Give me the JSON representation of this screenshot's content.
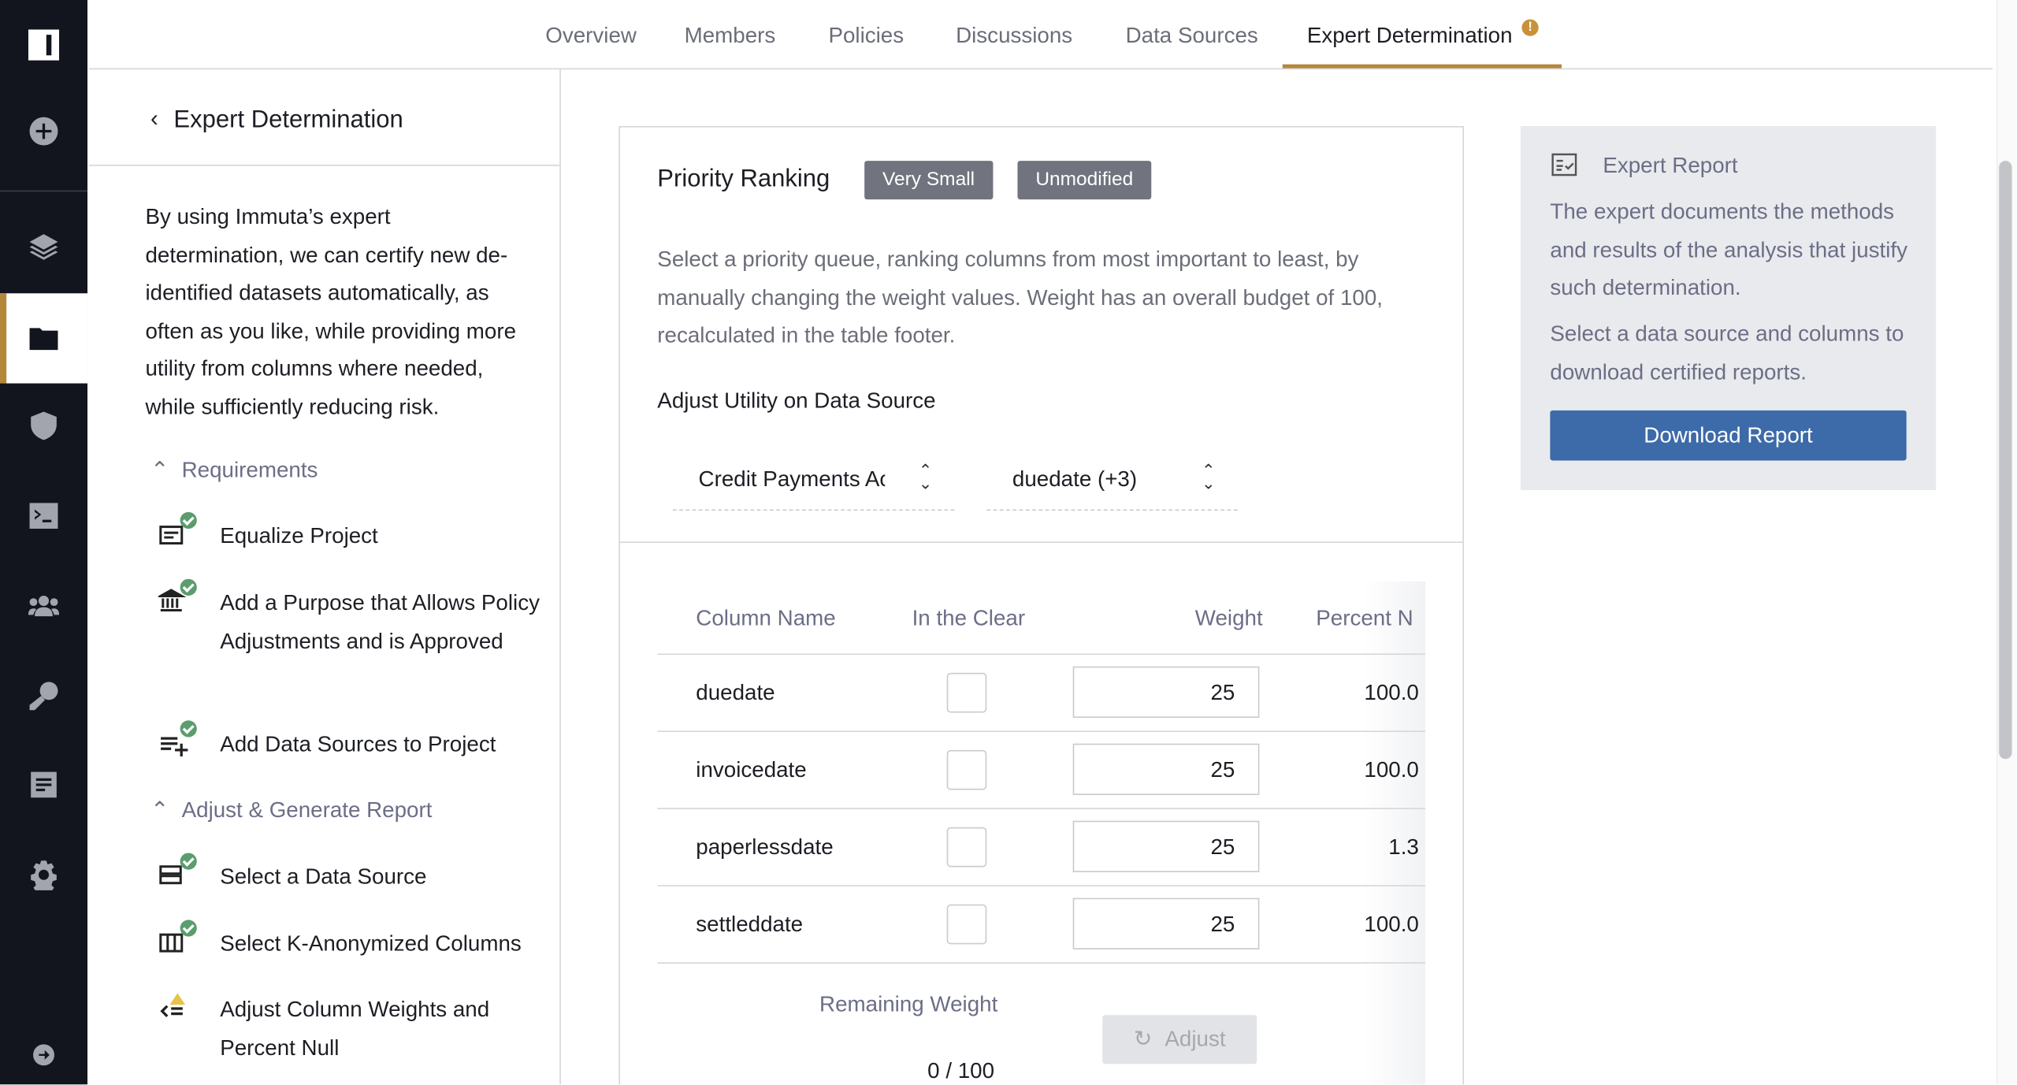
{
  "nav": {
    "items": [
      {
        "icon": "logo-icon"
      },
      {
        "icon": "plus-circle-icon"
      },
      {
        "icon": "layers-icon"
      },
      {
        "icon": "folder-icon",
        "active": true
      },
      {
        "icon": "shield-icon"
      },
      {
        "icon": "terminal-icon"
      },
      {
        "icon": "users-icon"
      },
      {
        "icon": "key-icon"
      },
      {
        "icon": "document-icon"
      },
      {
        "icon": "gear-icon"
      },
      {
        "icon": "arrow-right-circle-icon"
      }
    ],
    "accent": "#b5873a"
  },
  "tabs": [
    {
      "label": "Overview"
    },
    {
      "label": "Members"
    },
    {
      "label": "Policies"
    },
    {
      "label": "Discussions"
    },
    {
      "label": "Data Sources"
    },
    {
      "label": "Expert Determination",
      "active": true,
      "badge": "!"
    }
  ],
  "left": {
    "title": "Expert Determination",
    "intro": "By using Immuta’s expert determination, we can certify new de-identified datasets automatically, as often as you like, while providing more utility from columns where needed, while sufficiently reducing risk.",
    "sections": [
      {
        "label": "Requirements",
        "items": [
          {
            "label": "Equalize Project",
            "status": "complete"
          },
          {
            "label": "Add a Purpose that Allows Policy Adjustments and is Approved",
            "status": "complete"
          },
          {
            "label": "Add Data Sources to Project",
            "status": "complete"
          }
        ]
      },
      {
        "label": "Adjust & Generate Report",
        "items": [
          {
            "label": "Select a Data Source",
            "status": "complete"
          },
          {
            "label": "Select K-Anonymized Columns",
            "status": "complete"
          },
          {
            "label": "Adjust Column Weights and Percent Null",
            "status": "warning"
          }
        ]
      }
    ]
  },
  "card": {
    "title": "Priority Ranking",
    "badges": [
      "Very Small",
      "Unmodified"
    ],
    "description": "Select a priority queue, ranking columns from most important to least, by manually changing the weight values. Weight has an overall budget of 100, recalculated in the table footer.",
    "adjust_label": "Adjust Utility on Data Source",
    "data_source_select": "Credit Payments Ac",
    "columns_select": "duedate (+3)",
    "table": {
      "headers": [
        "Column Name",
        "In the Clear",
        "Weight",
        "Percent N"
      ],
      "rows": [
        {
          "name": "duedate",
          "clear": false,
          "weight": "25",
          "percent": "100.0"
        },
        {
          "name": "invoicedate",
          "clear": false,
          "weight": "25",
          "percent": "100.0"
        },
        {
          "name": "paperlessdate",
          "clear": false,
          "weight": "25",
          "percent": "1.3"
        },
        {
          "name": "settleddate",
          "clear": false,
          "weight": "25",
          "percent": "100.0"
        }
      ],
      "remaining_label": "Remaining Weight",
      "remaining_value": "0 / 100",
      "adjust_button": "Adjust"
    }
  },
  "report": {
    "title": "Expert Report",
    "text1": "The expert documents the methods and results of the analysis that justify such determination.",
    "text2": "Select a data source and columns to download certified reports.",
    "button": "Download Report",
    "button_color": "#3d6aa8"
  }
}
